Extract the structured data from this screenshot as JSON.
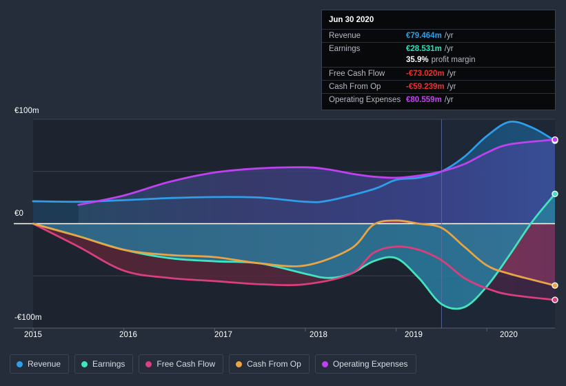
{
  "background": "#262d3a",
  "tooltip": {
    "title": "Jun 30 2020",
    "rows": [
      {
        "key": "Revenue",
        "value": "€79.464m",
        "unit": "/yr",
        "color": "#2f9ee8"
      },
      {
        "key": "Earnings",
        "value": "€28.531m",
        "unit": "/yr",
        "color": "#2ee0b9"
      },
      {
        "key": "",
        "value": "35.9%",
        "unit": "profit margin",
        "color": "#ffffff"
      },
      {
        "key": "Free Cash Flow",
        "value": "-€73.020m",
        "unit": "/yr",
        "color": "#f03030"
      },
      {
        "key": "Cash From Op",
        "value": "-€59.239m",
        "unit": "/yr",
        "color": "#f03030"
      },
      {
        "key": "Operating Expenses",
        "value": "€80.559m",
        "unit": "/yr",
        "color": "#c244f0"
      }
    ]
  },
  "legend": {
    "items": [
      {
        "label": "Revenue",
        "color": "#2f9ee8"
      },
      {
        "label": "Earnings",
        "color": "#43e3c0"
      },
      {
        "label": "Free Cash Flow",
        "color": "#d93f7c"
      },
      {
        "label": "Cash From Op",
        "color": "#e8a445"
      },
      {
        "label": "Operating Expenses",
        "color": "#bf41f0"
      }
    ]
  },
  "chart_data": {
    "type": "line",
    "title": "",
    "xlabel": "",
    "ylabel": "",
    "currency": "EUR",
    "units": "millions",
    "grid": true,
    "legend_position": "bottom",
    "ylim": [
      -100,
      100
    ],
    "xlim": [
      2015.0,
      2020.75
    ],
    "y_ticks": [
      100,
      0,
      -100
    ],
    "y_tick_labels": [
      "€100m",
      "€0",
      "-€100m"
    ],
    "y_gridlines": [
      100,
      50,
      0,
      -50,
      -100
    ],
    "x_ticks": [
      2015,
      2016,
      2017,
      2018,
      2019,
      2020
    ],
    "x_tick_labels": [
      "2015",
      "2016",
      "2017",
      "2018",
      "2019",
      "2020"
    ],
    "cursor_x": 2019.5,
    "cursor_label": "Jun 30 2020",
    "series": [
      {
        "name": "Revenue",
        "color": "#2f9ee8",
        "x": [
          2015.0,
          2015.5,
          2016.0,
          2016.5,
          2017.0,
          2017.5,
          2018.0,
          2018.25,
          2018.75,
          2019.0,
          2019.25,
          2019.5,
          2019.75,
          2020.0,
          2020.25,
          2020.5,
          2020.75
        ],
        "values": [
          21.5,
          21.0,
          22.5,
          24.5,
          25.5,
          25.0,
          21.0,
          22.0,
          33.0,
          42.0,
          44.0,
          50.0,
          64.0,
          84.0,
          97.5,
          92.0,
          79.5
        ]
      },
      {
        "name": "Earnings",
        "color": "#43e3c0",
        "x": [
          2015.0,
          2015.5,
          2016.0,
          2016.5,
          2017.0,
          2017.5,
          2018.0,
          2018.25,
          2018.5,
          2018.75,
          2019.0,
          2019.25,
          2019.5,
          2019.75,
          2020.0,
          2020.25,
          2020.5,
          2020.75
        ],
        "values": [
          0.0,
          -12.0,
          -25.0,
          -33.0,
          -36.0,
          -38.0,
          -48.0,
          -52.0,
          -48.0,
          -36.0,
          -33.0,
          -52.0,
          -77.0,
          -80.0,
          -60.0,
          -30.0,
          2.0,
          28.5
        ]
      },
      {
        "name": "Free Cash Flow",
        "color": "#d93f7c",
        "x": [
          2015.0,
          2015.5,
          2016.0,
          2016.5,
          2017.0,
          2017.5,
          2018.0,
          2018.5,
          2018.75,
          2019.0,
          2019.25,
          2019.5,
          2019.75,
          2020.0,
          2020.25,
          2020.75
        ],
        "values": [
          0.0,
          -22.0,
          -45.0,
          -52.0,
          -55.0,
          -58.0,
          -58.0,
          -48.0,
          -28.0,
          -22.0,
          -25.0,
          -35.0,
          -52.0,
          -62.0,
          -68.0,
          -73.0
        ]
      },
      {
        "name": "Cash From Op",
        "color": "#e8a445",
        "x": [
          2015.0,
          2015.5,
          2016.0,
          2016.5,
          2017.0,
          2017.5,
          2018.0,
          2018.5,
          2018.75,
          2019.0,
          2019.25,
          2019.5,
          2019.75,
          2020.0,
          2020.25,
          2020.75
        ],
        "values": [
          0.0,
          -12.0,
          -25.0,
          -30.0,
          -32.0,
          -38.0,
          -40.0,
          -24.0,
          -1.0,
          3.0,
          0.0,
          -4.0,
          -22.0,
          -40.0,
          -48.0,
          -59.2
        ]
      },
      {
        "name": "Operating Expenses",
        "color": "#bf41f0",
        "x": [
          2015.5,
          2016.0,
          2016.5,
          2017.0,
          2017.5,
          2018.0,
          2018.25,
          2018.5,
          2018.75,
          2019.0,
          2019.25,
          2019.5,
          2019.75,
          2020.0,
          2020.25,
          2020.75
        ],
        "values": [
          18.0,
          27.0,
          40.0,
          49.0,
          53.0,
          54.0,
          52.0,
          48.0,
          45.0,
          44.0,
          46.0,
          50.0,
          57.0,
          68.0,
          76.0,
          80.5
        ]
      }
    ]
  }
}
